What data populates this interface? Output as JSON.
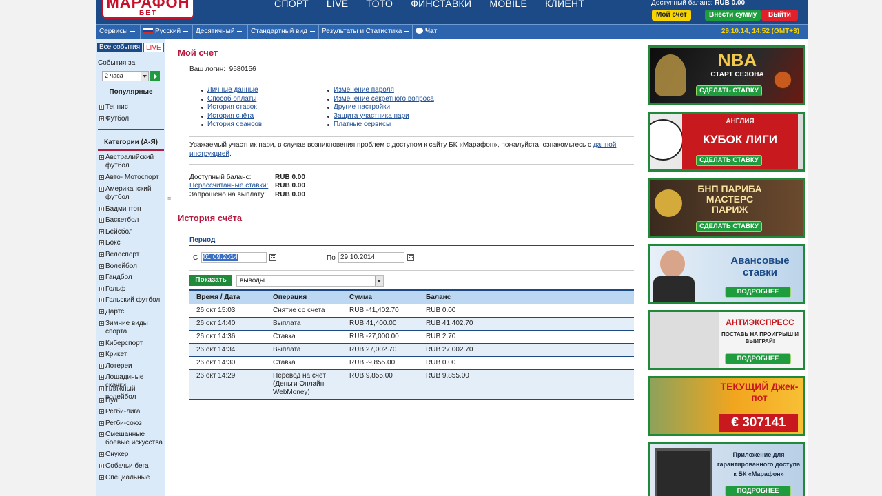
{
  "header": {
    "logo_top": "МАРАФОН",
    "logo_bottom": "БЕТ",
    "nav": [
      "СПОРТ",
      "LIVE",
      "ТОТО",
      "ФИНСТАВКИ",
      "MOBILE",
      "КЛИЕНТ"
    ],
    "balance_label": "Доступный баланс:",
    "balance_value": "RUB 0.00",
    "my_account": "Мой счет",
    "deposit": "Внести сумму",
    "exit": "Выйти"
  },
  "subnav": {
    "services": "Сервисы",
    "language": "Русский",
    "odds_format": "Десятичный",
    "view": "Стандартный вид",
    "results": "Результаты и Статистика",
    "chat": "Чат",
    "datetime": "29.10.14, 14:52 (GMT+3)"
  },
  "sidebar": {
    "tab_all": "Все события",
    "tab_live": "LIVE",
    "events_for": "События за",
    "hours_value": "2 часа",
    "popular_title": "Популярные",
    "popular": [
      "Теннис",
      "Футбол"
    ],
    "categories_title": "Категории (А-Я)",
    "categories": [
      "Австралийский футбол",
      "Авто- Мотоспорт",
      "Американский футбол",
      "Бадминтон",
      "Баскетбол",
      "Бейсбол",
      "Бокс",
      "Велоспорт",
      "Волейбол",
      "Гандбол",
      "Гольф",
      "Гэльский футбол",
      "Дартс",
      "Зимние виды спорта",
      "Киберспорт",
      "Крикет",
      "Лотереи",
      "Лошадиные скачки",
      "Пляжный волейбол",
      "Пул",
      "Регби-лига",
      "Регби-союз",
      "Смешанные боевые искусства",
      "Снукер",
      "Собачьи бега",
      "Специальные"
    ]
  },
  "account": {
    "title": "Мой счет",
    "login_label": "Ваш логин:",
    "login_value": "9580156",
    "links_left": [
      "Личные данные",
      "Способ оплаты",
      "История ставок",
      "История счёта",
      "История сеансов"
    ],
    "links_right": [
      "Изменение пароля",
      "Изменение секретного вопроса",
      "Другие настройки",
      "Защита участника пари",
      "Платные сервисы"
    ],
    "notice_text": "Уважаемый участник пари, в случае возникновения проблем с доступом к сайту БК «Марафон», пожалуйста, ознакомьтесь с ",
    "notice_link": "данной инструкцией",
    "notice_end": ".",
    "available_label": "Доступный баланс:",
    "available_value": "RUB 0.00",
    "unsettled_label": "Нерассчитанные ставки:",
    "unsettled_value": "RUB 0.00",
    "withdraw_label": "Запрошено на выплату:",
    "withdraw_value": "RUB 0.00"
  },
  "history": {
    "title": "История счёта",
    "period_label": "Период",
    "from_label": "С",
    "from_value": "01.09.2014",
    "to_label": "По",
    "to_value": "29.10.2014",
    "show_button": "Показать",
    "operation_filter": "выводы",
    "columns": [
      "Время / Дата",
      "Операция",
      "Сумма",
      "Баланс"
    ],
    "rows": [
      [
        "26 окт 15:03",
        "Снятие со счета",
        "RUB -41,402.70",
        "RUB 0.00"
      ],
      [
        "26 окт 14:40",
        "Выплата",
        "RUB 41,400.00",
        "RUB 41,402.70"
      ],
      [
        "26 окт 14:36",
        "Ставка",
        "RUB -27,000.00",
        "RUB 2.70"
      ],
      [
        "26 окт 14:34",
        "Выплата",
        "RUB 27,002.70",
        "RUB 27,002.70"
      ],
      [
        "26 окт 14:30",
        "Ставка",
        "RUB -9,855.00",
        "RUB 0.00"
      ],
      [
        "26 окт 14:29",
        "Перевод на счёт (Деньги Онлайн WebMoney)",
        "RUB 9,855.00",
        "RUB 9,855.00"
      ]
    ]
  },
  "banners": [
    {
      "title": "NBA",
      "subtitle": "СТАРТ СЕЗОНА",
      "button": "СДЕЛАТЬ СТАВКУ"
    },
    {
      "title": "КУБОК ЛИГИ",
      "subtitle": "АНГЛИЯ",
      "button": "СДЕЛАТЬ СТАВКУ"
    },
    {
      "title": "БНП ПАРИБА МАСТЕРС ПАРИЖ",
      "subtitle": "",
      "button": "СДЕЛАТЬ СТАВКУ"
    },
    {
      "title": "Авансовые ставки",
      "subtitle": "",
      "button": "ПОДРОБНЕЕ"
    },
    {
      "title": "АНТИЭКСПРЕСС",
      "subtitle": "ПОСТАВЬ НА ПРОИГРЫШ И ВЫИГРАЙ!",
      "button": "ПОДРОБНЕЕ"
    },
    {
      "title": "ТЕКУЩИЙ Джек-пот",
      "subtitle": "€ 307141",
      "button": ""
    },
    {
      "title": "Приложение для гарантированного доступа к БК «Марафон»",
      "subtitle": "",
      "button": "ПОДРОБНЕЕ"
    }
  ],
  "colors": {
    "brand_blue": "#1b4a87",
    "accent_red": "#b21a3e",
    "accent_green": "#1f9d3e",
    "accent_yellow": "#f8d400"
  }
}
